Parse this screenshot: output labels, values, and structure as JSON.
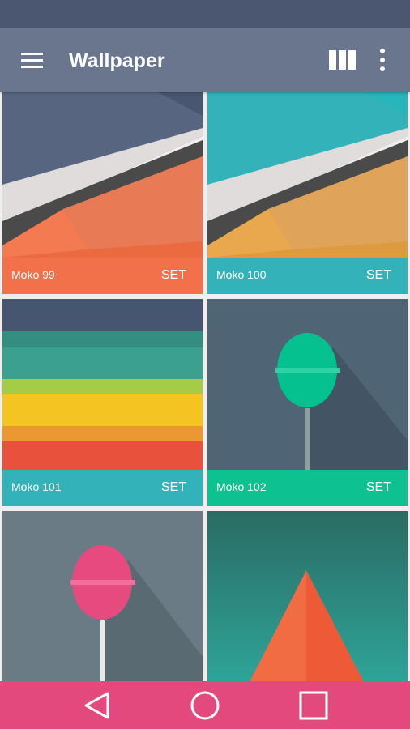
{
  "app": {
    "title": "Wallpaper",
    "icons": {
      "menu": "hamburger-menu-icon",
      "columns": "column-view-icon",
      "more": "more-vertical-icon"
    }
  },
  "colors": {
    "statusbar": "#4b5770",
    "appbar": "#69768d",
    "navbar": "#e3497c",
    "background": "#eeeeee"
  },
  "wallpapers": [
    {
      "name": "Moko 99",
      "action": "SET",
      "caption_color": "#f2714a"
    },
    {
      "name": "Moko 100",
      "action": "SET",
      "caption_color": "#33b3b9"
    },
    {
      "name": "Moko 101",
      "action": "SET",
      "caption_color": "#33b3b9"
    },
    {
      "name": "Moko 102",
      "action": "SET",
      "caption_color": "#0dc190"
    },
    {
      "name": "",
      "action": ""
    },
    {
      "name": "",
      "action": ""
    }
  ],
  "navbar": {
    "icons": [
      "back-icon",
      "home-icon",
      "recents-icon"
    ]
  }
}
